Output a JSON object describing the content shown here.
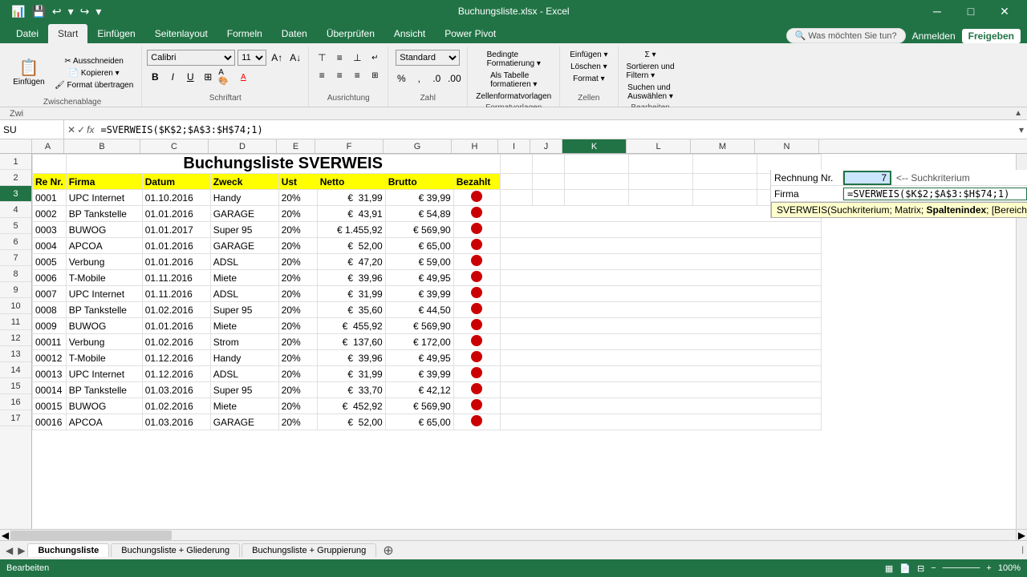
{
  "app": {
    "title": "Buchungsliste.xlsx - Excel",
    "close_btn": "✕",
    "min_btn": "─",
    "max_btn": "□"
  },
  "ribbon": {
    "tabs": [
      "Datei",
      "Start",
      "Einfügen",
      "Seitenlayout",
      "Formeln",
      "Daten",
      "Überprüfen",
      "Ansicht",
      "Power Pivot"
    ],
    "active_tab": "Start",
    "search_placeholder": "Was möchten Sie tun?",
    "right_links": [
      "Anmelden",
      "Freigeben"
    ],
    "groups": {
      "zwischenablage_label": "Zwischenablage",
      "schriftart_label": "Schriftart",
      "ausrichtung_label": "Ausrichtung",
      "zahl_label": "Zahl",
      "formatvorlagen_label": "Formatvorlagen",
      "zellen_label": "Zellen",
      "bearbeiten_label": "Bearbeiten"
    },
    "font_name": "Calibri",
    "font_size": "11",
    "number_format": "Standard",
    "einfuegen_btn": "Einfügen",
    "loeschen_btn": "Löschen",
    "format_btn": "Format",
    "sortieren_btn": "Sortieren und\nFiltern",
    "suchen_btn": "Suchen und\nAuswählen",
    "bedingte_btn": "Bedingte\nFormatierung",
    "als_tabelle_btn": "Als Tabelle\nformatieren",
    "zellenformat_btn": "Zellenformatvorlagen"
  },
  "formula_bar": {
    "name_box": "SU",
    "formula": "=SVERWEIS($K$2;$A$3:$H$74;1)"
  },
  "columns": {
    "headers": [
      "A",
      "B",
      "C",
      "D",
      "E",
      "F",
      "G",
      "H",
      "I",
      "J",
      "K",
      "L",
      "M",
      "N"
    ],
    "labels": {
      "A": "Re Nr.",
      "B": "Firma",
      "C": "Datum",
      "D": "Zweck",
      "E": "Ust",
      "F": "Netto",
      "G": "Brutto",
      "H": "Bezahlt"
    }
  },
  "title_row": "Buchungsliste SVERWEIS",
  "rows": [
    {
      "re": "0001",
      "firma": "UPC Internet",
      "datum": "01.10.2016",
      "zweck": "Handy",
      "ust": "20%",
      "netto": "€  31,99",
      "brutto": "€ 39,99",
      "bezahlt": true
    },
    {
      "re": "0002",
      "firma": "BP Tankstelle",
      "datum": "01.01.2016",
      "zweck": "GARAGE",
      "ust": "20%",
      "netto": "€",
      "netto2": "43,91",
      "brutto": "€ 54,89",
      "bezahlt": true
    },
    {
      "re": "0003",
      "firma": "BUWOG",
      "datum": "01.01.2017",
      "zweck": "Super 95",
      "ust": "20%",
      "netto": "€ 1.455,92",
      "brutto": "€ 569,90",
      "bezahlt": true
    },
    {
      "re": "0004",
      "firma": "APCOA",
      "datum": "01.01.2016",
      "zweck": "GARAGE",
      "ust": "20%",
      "netto": "€",
      "netto2": "52,00",
      "brutto": "€ 65,00",
      "bezahlt": true
    },
    {
      "re": "0005",
      "firma": "Verbung",
      "datum": "01.01.2016",
      "zweck": "ADSL",
      "ust": "20%",
      "netto": "€",
      "netto2": "47,20",
      "brutto": "€ 59,00",
      "bezahlt": true
    },
    {
      "re": "0006",
      "firma": "T-Mobile",
      "datum": "01.11.2016",
      "zweck": "Miete",
      "ust": "20%",
      "netto": "€",
      "netto2": "39,96",
      "brutto": "€ 49,95",
      "bezahlt": true
    },
    {
      "re": "0007",
      "firma": "UPC Internet",
      "datum": "01.11.2016",
      "zweck": "ADSL",
      "ust": "20%",
      "netto": "€",
      "netto2": "31,99",
      "brutto": "€ 39,99",
      "bezahlt": true
    },
    {
      "re": "0008",
      "firma": "BP Tankstelle",
      "datum": "01.02.2016",
      "zweck": "Super 95",
      "ust": "20%",
      "netto": "€",
      "netto2": "35,60",
      "brutto": "€ 44,50",
      "bezahlt": true
    },
    {
      "re": "0009",
      "firma": "BUWOG",
      "datum": "01.01.2016",
      "zweck": "Miete",
      "ust": "20%",
      "netto": "€",
      "netto2": "455,92",
      "brutto": "€ 569,90",
      "bezahlt": true
    },
    {
      "re": "00011",
      "firma": "Verbung",
      "datum": "01.02.2016",
      "zweck": "Strom",
      "ust": "20%",
      "netto": "€",
      "netto2": "137,60",
      "brutto": "€ 172,00",
      "bezahlt": true
    },
    {
      "re": "00012",
      "firma": "T-Mobile",
      "datum": "01.12.2016",
      "zweck": "Handy",
      "ust": "20%",
      "netto": "€",
      "netto2": "39,96",
      "brutto": "€ 49,95",
      "bezahlt": true
    },
    {
      "re": "00013",
      "firma": "UPC Internet",
      "datum": "01.12.2016",
      "zweck": "ADSL",
      "ust": "20%",
      "netto": "€",
      "netto2": "31,99",
      "brutto": "€ 39,99",
      "bezahlt": true
    },
    {
      "re": "00014",
      "firma": "BP Tankstelle",
      "datum": "01.03.2016",
      "zweck": "Super 95",
      "ust": "20%",
      "netto": "€",
      "netto2": "33,70",
      "brutto": "€ 42,12",
      "bezahlt": true
    },
    {
      "re": "00015",
      "firma": "BUWOG",
      "datum": "01.02.2016",
      "zweck": "Miete",
      "ust": "20%",
      "netto": "€",
      "netto2": "452,92",
      "brutto": "€ 569,90",
      "bezahlt": true
    },
    {
      "re": "00016",
      "firma": "APCOA",
      "datum": "01.03.2016",
      "zweck": "GARAGE",
      "ust": "20%",
      "netto": "€",
      "netto2": "52,00",
      "brutto": "€ 65,00",
      "bezahlt": true
    }
  ],
  "right_panel": {
    "rechnung_label": "Rechnung Nr.",
    "rechnung_value": "7",
    "suchkriterium_comment": "<-- Suchkriterium",
    "firma_label": "Firma",
    "firma_formula": "=SVERWEIS($K$2;$A$3:$H$74;1)",
    "tooltip": "SVERWEIS(Suchkriterium; Matrix; ",
    "tooltip_bold": "Spaltenindex",
    "tooltip_end": "; [Bereich_Verw..."
  },
  "format_comment": "Format \"",
  "sheet_tabs": [
    "Buchungsliste",
    "Buchungsliste + Gliederung",
    "Buchungsliste + Gruppierung"
  ],
  "active_sheet": "Buchungsliste",
  "status_bar": {
    "mode": "Bearbeiten",
    "right_icons": [
      "grid",
      "layout",
      "zoom"
    ]
  },
  "row_numbers": [
    1,
    2,
    3,
    4,
    5,
    6,
    7,
    8,
    9,
    10,
    11,
    12,
    13,
    14,
    15,
    16,
    17
  ]
}
